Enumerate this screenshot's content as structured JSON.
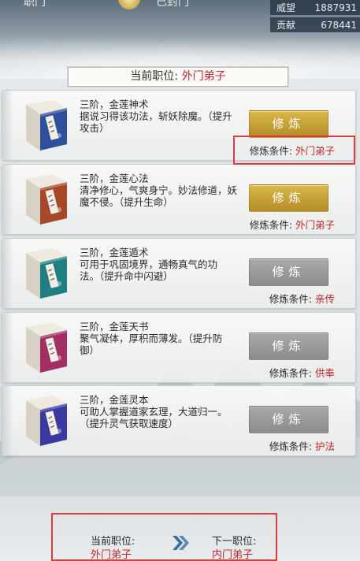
{
  "header": {
    "left_label": "职门",
    "sect_name": "已封门"
  },
  "stats": [
    {
      "label": "威望",
      "value": "1887931"
    },
    {
      "label": "贡献",
      "value": "678441"
    }
  ],
  "current_rank": {
    "label": "当前职位:",
    "value": "外门弟子"
  },
  "skills": [
    {
      "title": "三阶，金莲神术",
      "desc": "据说习得该功法，斩妖除魔。（提升攻击）",
      "button": "修炼",
      "enabled": true,
      "cond_label": "修炼条件:",
      "cond_value": "外门弟子",
      "book_color": "#2d4f9c"
    },
    {
      "title": "三阶，金莲心法",
      "desc": "清净修心，气爽身宁。妙法修道，妖魔不侵。（提升生命）",
      "button": "修炼",
      "enabled": true,
      "cond_label": "修炼条件:",
      "cond_value": "外门弟子",
      "book_color": "#a8482a"
    },
    {
      "title": "三阶，金莲遁术",
      "desc": "可用于巩固境界，通畅真气的功法。（提升命中闪避）",
      "button": "修炼",
      "enabled": false,
      "cond_label": "修炼条件:",
      "cond_value": "亲传",
      "book_color": "#1f7f80"
    },
    {
      "title": "三阶，金莲天书",
      "desc": "聚气凝体，厚积而薄发。（提升防御）",
      "button": "修炼",
      "enabled": false,
      "cond_label": "修炼条件:",
      "cond_value": "供奉",
      "book_color": "#a22e62"
    },
    {
      "title": "三阶，金莲灵本",
      "desc": "可助人掌握道家玄理，大道归一。（提升灵气获取速度）",
      "button": "修炼",
      "enabled": false,
      "cond_label": "修炼条件:",
      "cond_value": "护法",
      "book_color": "#3a3aa0"
    }
  ],
  "promotion": {
    "current_label": "当前职位:",
    "current_value": "外门弟子",
    "next_label": "下一职位:",
    "next_value": "内门弟子"
  },
  "colors": {
    "accent_red": "#c0282a",
    "gold_button": "#c9a43a",
    "gray_button": "#9a9a9a"
  }
}
